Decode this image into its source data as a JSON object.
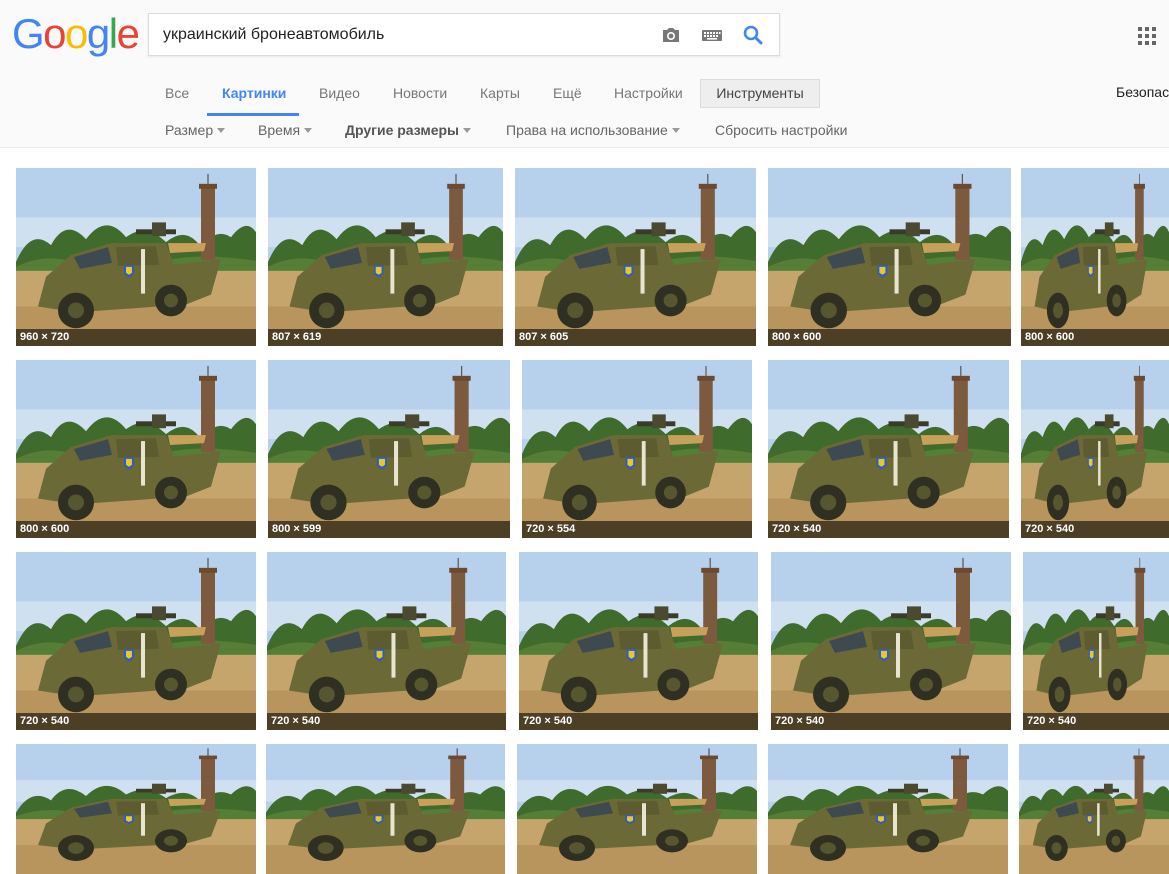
{
  "logo": {
    "letters": [
      "G",
      "o",
      "o",
      "g",
      "l",
      "e"
    ]
  },
  "search": {
    "query": "украинский бронеавтомобиль"
  },
  "icons": {
    "camera": "camera-icon",
    "keyboard": "keyboard-icon",
    "search": "search-icon",
    "apps": "apps-grid-icon"
  },
  "tabs": [
    {
      "label": "Все",
      "active": false
    },
    {
      "label": "Картинки",
      "active": true
    },
    {
      "label": "Видео",
      "active": false
    },
    {
      "label": "Новости",
      "active": false
    },
    {
      "label": "Карты",
      "active": false
    },
    {
      "label": "Ещё",
      "active": false
    },
    {
      "label": "Настройки",
      "active": false
    }
  ],
  "tools_label": "Инструменты",
  "safesearch_label": "Безопас",
  "filters": [
    {
      "label": "Размер",
      "dropdown": true,
      "bold": false
    },
    {
      "label": "Время",
      "dropdown": true,
      "bold": false
    },
    {
      "label": "Другие размеры",
      "dropdown": true,
      "bold": true
    },
    {
      "label": "Права на использование",
      "dropdown": true,
      "bold": false
    },
    {
      "label": "Сбросить настройки",
      "dropdown": false,
      "bold": false
    }
  ],
  "results": [
    [
      "960 × 720",
      "807 × 619",
      "807 × 605",
      "800 × 600",
      "800 × 600"
    ],
    [
      "800 × 600",
      "800 × 599",
      "720 × 554",
      "720 × 540",
      "720 × 540"
    ],
    [
      "720 × 540",
      "720 × 540",
      "720 × 540",
      "720 × 540",
      "720 × 540"
    ],
    [
      "",
      "",
      "",
      "",
      ""
    ]
  ],
  "colors": {
    "accent": "#4285f4",
    "sky": "#b9d3ec",
    "vehicle": "#6f6e3a",
    "ground": "#c4a46a"
  }
}
